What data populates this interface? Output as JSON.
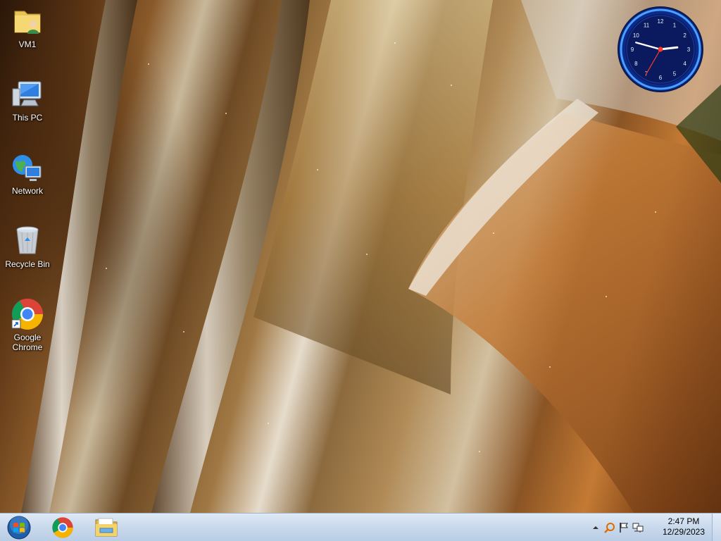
{
  "desktop": {
    "icons": [
      {
        "label": "VM1",
        "icon": "user-folder-icon"
      },
      {
        "label": "This PC",
        "icon": "computer-icon"
      },
      {
        "label": "Network",
        "icon": "network-icon"
      },
      {
        "label": "Recycle Bin",
        "icon": "recycle-bin-icon"
      },
      {
        "label": "Google\nChrome",
        "icon": "chrome-icon"
      }
    ]
  },
  "clock_gadget": {
    "numerals": [
      "12",
      "1",
      "2",
      "3",
      "4",
      "5",
      "6",
      "7",
      "8",
      "9",
      "10",
      "11"
    ],
    "hour": 14,
    "minute": 47,
    "second": 35
  },
  "taskbar": {
    "start": {
      "icon": "windows-start-orb-icon"
    },
    "pinned": [
      {
        "name": "Google Chrome",
        "icon": "chrome-icon"
      },
      {
        "name": "File Explorer",
        "icon": "folder-icon"
      }
    ],
    "tray": {
      "icons": [
        "show-hidden-icons-chevron-icon",
        "search-magnifier-icon",
        "action-center-flag-icon",
        "network-status-icon"
      ],
      "time": "2:47 PM",
      "date": "12/29/2023"
    }
  },
  "colors": {
    "taskbar_top": "#dfe9f5",
    "taskbar_bottom": "#b9cde6",
    "clock_ring": "#1a55d8",
    "clock_face": "#0b1a5e"
  }
}
